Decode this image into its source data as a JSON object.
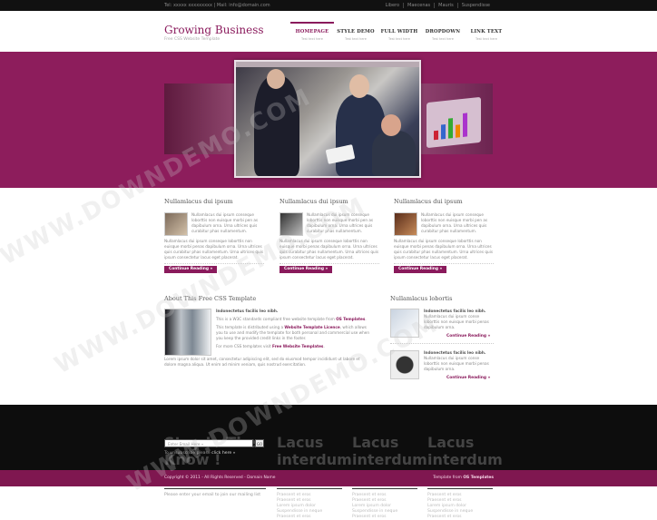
{
  "topbar": {
    "contact": "Tel: xxxxx xxxxxxxxx | Mail: info@domain.com",
    "links": [
      "Libero",
      "Maecenas",
      "Mauris",
      "Suspendisse"
    ]
  },
  "header": {
    "brand": "Growing Business",
    "tagline": "Free CSS Website Template",
    "nav": [
      {
        "label": "HOMEPAGE",
        "sub": "Test text here",
        "active": true
      },
      {
        "label": "STYLE DEMO",
        "sub": "Test text here"
      },
      {
        "label": "FULL WIDTH",
        "sub": "Test text here"
      },
      {
        "label": "DROPDOWN",
        "sub": "Test text here"
      },
      {
        "label": "LINK TEXT",
        "sub": "Test text here"
      }
    ]
  },
  "features": [
    {
      "title": "Nullamlacus dui ipsum",
      "text_a": "Nullamlacus dui ipsum conseque loborttis non euisque morbi pen as dapibulum orna. Urna ultrices quis curabitur phas nullamentum.",
      "text_b": "Nullamlacus dui ipsum conseque loborttis non euisque morbi penas dapibulum orna. Urna ultrices quis curabitur phas nullamentum. Urna ultrices quis ipsum consectetur lacus eget placerat.",
      "button": "Continue Reading »"
    },
    {
      "title": "Nullamlacus dui ipsum",
      "text_a": "Nullamlacus dui ipsum conseque loborttis non euisque morbi pen as dapibulum orna. Urna ultrices quis curabitur phas nullamentum.",
      "text_b": "Nullamlacus dui ipsum conseque loborttis non euisque morbi penas dapibulum orna. Urna ultrices quis curabitur phas nullamentum. Urna ultrices quis ipsum consectetur lacus eget placerat.",
      "button": "Continue Reading »"
    },
    {
      "title": "Nullamlacus dui ipsum",
      "text_a": "Nullamlacus dui ipsum conseque loborttis non euisque morbi pen as dapibulum orna. Urna ultrices quis curabitur phas nullamentum.",
      "text_b": "Nullamlacus dui ipsum conseque loborttis non euisque morbi penas dapibulum orna. Urna ultrices quis curabitur phas nullamentum. Urna ultrices quis ipsum consectetur lacus eget placerat.",
      "button": "Continue Reading »"
    }
  ],
  "about": {
    "title": "About This Free CSS Template",
    "lead": "Indonectetus facilis leo nibh.",
    "p1_prefix": "This is a W3C standards compliant free website template from ",
    "p1_link": "OS Templates",
    "p1_suffix": ".",
    "p2_prefix": "This template is distributed using a ",
    "p2_link": "Website Template Licence",
    "p2_suffix": ", which allows you to use and modify the template for both personal and commercial use when you keep the provided credit links in the footer.",
    "p3_prefix": "For more CSS templates visit ",
    "p3_link": "Free Website Templates",
    "p3_suffix": ".",
    "p4": "Lorem ipsum dolor sit amet, consectetur adipiscing elit, sed do eiusmod tempor incididunt ut labore et dolore magna aliqua. Ut enim ad minim veniam, quis nostrud exercitation."
  },
  "side": {
    "title": "Nullamlacus lobortis",
    "items": [
      {
        "lead": "Indonectetus facilis leo nibh.",
        "text": "Nullamlacus dui ipsum conse loborttis non euisque morbi penas dapibulum orna.",
        "more": "Continue Reading »"
      },
      {
        "lead": "Indonectetus facilis leo nibh.",
        "text": "Nullamlacus dui ipsum conse loborttis non euisque morbi penas dapibulum orna.",
        "more": "Continue Reading »"
      }
    ]
  },
  "footer": {
    "newsletter_title": "Stay In The Know !",
    "newsletter_text": "Please enter your email to join our mailing list",
    "email_placeholder": "Enter Email Here »",
    "submit": "GO",
    "unsubscribe_prefix": "To unsubscribe please ",
    "unsubscribe_link": "click here »",
    "columns": [
      {
        "title": "Lacus interdum",
        "items": [
          "Praesent et eros",
          "Praesent et eros",
          "Lorem ipsum dolor",
          "Suspendisse in neque",
          "Praesent et eros"
        ]
      },
      {
        "title": "Lacus interdum",
        "items": [
          "Praesent et eros",
          "Praesent et eros",
          "Lorem ipsum dolor",
          "Suspendisse in neque",
          "Praesent et eros"
        ]
      },
      {
        "title": "Lacus interdum",
        "items": [
          "Praesent et eros",
          "Praesent et eros",
          "Lorem ipsum dolor",
          "Suspendisse in neque",
          "Praesent et eros"
        ]
      }
    ]
  },
  "copyright": {
    "left": "Copyright © 2011 - All Rights Reserved - Domain Name",
    "right_prefix": "Template from ",
    "right_link": "OS Templates"
  },
  "watermark": "WWW.DOWNDEMO.COM",
  "colors": {
    "accent": "#8a1a5c",
    "banner": "#8d1d5c",
    "footer": "#0d0d0d"
  }
}
